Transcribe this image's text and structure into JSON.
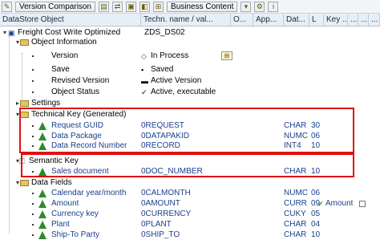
{
  "toolbar": {
    "version_comparison": "Version Comparison",
    "business_content": "Business Content"
  },
  "columns": [
    "DataStore Object",
    "Techn. name / val...",
    "O...",
    "App...",
    "Dat...",
    "L",
    "Key ...",
    "...",
    "...",
    "..."
  ],
  "tree": {
    "root": {
      "label": "Freight Cost Write Optimized",
      "tech": "ZDS_DS02"
    },
    "object_information": "Object Information",
    "version": {
      "label": "Version",
      "value": "In Process"
    },
    "save": {
      "label": "Save",
      "value": "Saved"
    },
    "revised_version": {
      "label": "Revised Version",
      "value": "Active Version"
    },
    "object_status": {
      "label": "Object Status",
      "value": "Active, executable"
    },
    "settings": "Settings",
    "technical_key": "Technical Key (Generated)",
    "semantic_key": "Semantic Key",
    "data_fields": "Data Fields"
  },
  "technical_key_rows": [
    {
      "label": "Request GUID",
      "tech": "0REQUEST",
      "type": "CHAR",
      "len": "30"
    },
    {
      "label": "Data Package",
      "tech": "0DATAPAKID",
      "type": "NUMC",
      "len": "06"
    },
    {
      "label": "Data Record Number",
      "tech": "0RECORD",
      "type": "INT4",
      "len": "10"
    }
  ],
  "semantic_key_rows": [
    {
      "label": "Sales document",
      "tech": "0DOC_NUMBER",
      "type": "CHAR",
      "len": "10"
    }
  ],
  "data_field_rows": [
    {
      "label": "Calendar year/month",
      "tech": "0CALMONTH",
      "type": "NUMC",
      "len": "06"
    },
    {
      "label": "Amount",
      "tech": "0AMOUNT",
      "type": "CURR",
      "len": "09",
      "key": "Amount"
    },
    {
      "label": "Currency key",
      "tech": "0CURRENCY",
      "type": "CUKY",
      "len": "05"
    },
    {
      "label": "Plant",
      "tech": "0PLANT",
      "type": "CHAR",
      "len": "04"
    },
    {
      "label": "Ship-To Party",
      "tech": "0SHIP_TO",
      "type": "CHAR",
      "len": "10"
    }
  ],
  "colors": {
    "header_bg": "#e7eef7",
    "highlight": "#e01010",
    "text_blue": "#1a3f8c"
  }
}
